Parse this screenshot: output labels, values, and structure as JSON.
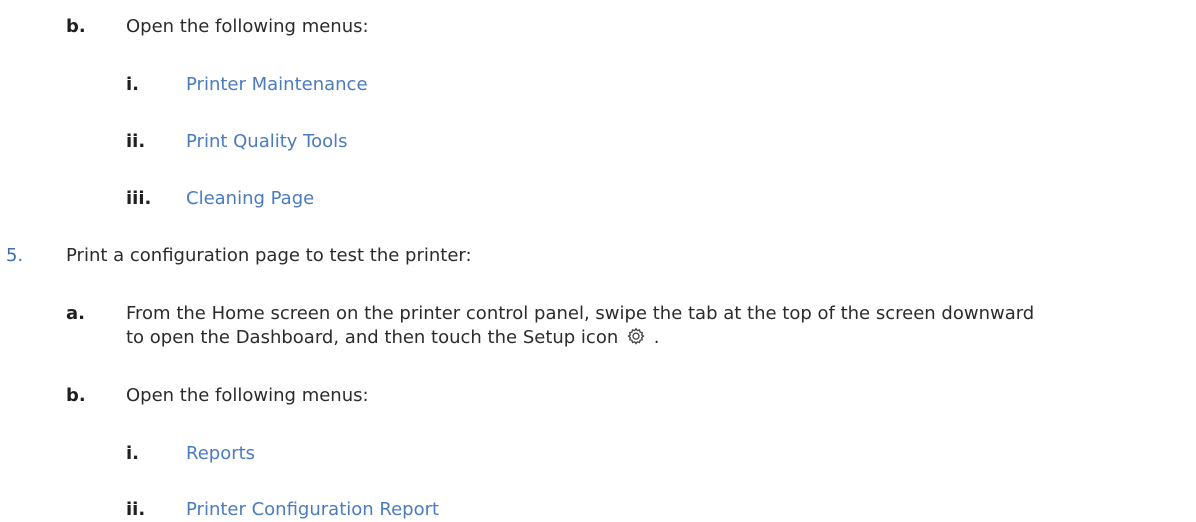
{
  "step4": {
    "b": {
      "marker": "b.",
      "text": "Open the following menus:",
      "items": [
        {
          "marker": "i.",
          "label": "Printer Maintenance"
        },
        {
          "marker": "ii.",
          "label": "Print Quality Tools"
        },
        {
          "marker": "iii.",
          "label": "Cleaning Page"
        }
      ]
    }
  },
  "step5": {
    "marker": "5.",
    "text": "Print a configuration page to test the printer:",
    "a": {
      "marker": "a.",
      "text_line1": "From the Home screen on the printer control panel, swipe the tab at the top of the screen downward",
      "text_line2_before": "to open the Dashboard, and then touch the Setup icon",
      "text_line2_after": ".",
      "icon": "gear-icon"
    },
    "b": {
      "marker": "b.",
      "text": "Open the following menus:",
      "items": [
        {
          "marker": "i.",
          "label": "Reports"
        },
        {
          "marker": "ii.",
          "label": "Printer Configuration Report"
        }
      ]
    }
  },
  "colors": {
    "link": "#4a7bbf",
    "step_number": "#3a6fb0",
    "text": "#2b2b2b"
  }
}
